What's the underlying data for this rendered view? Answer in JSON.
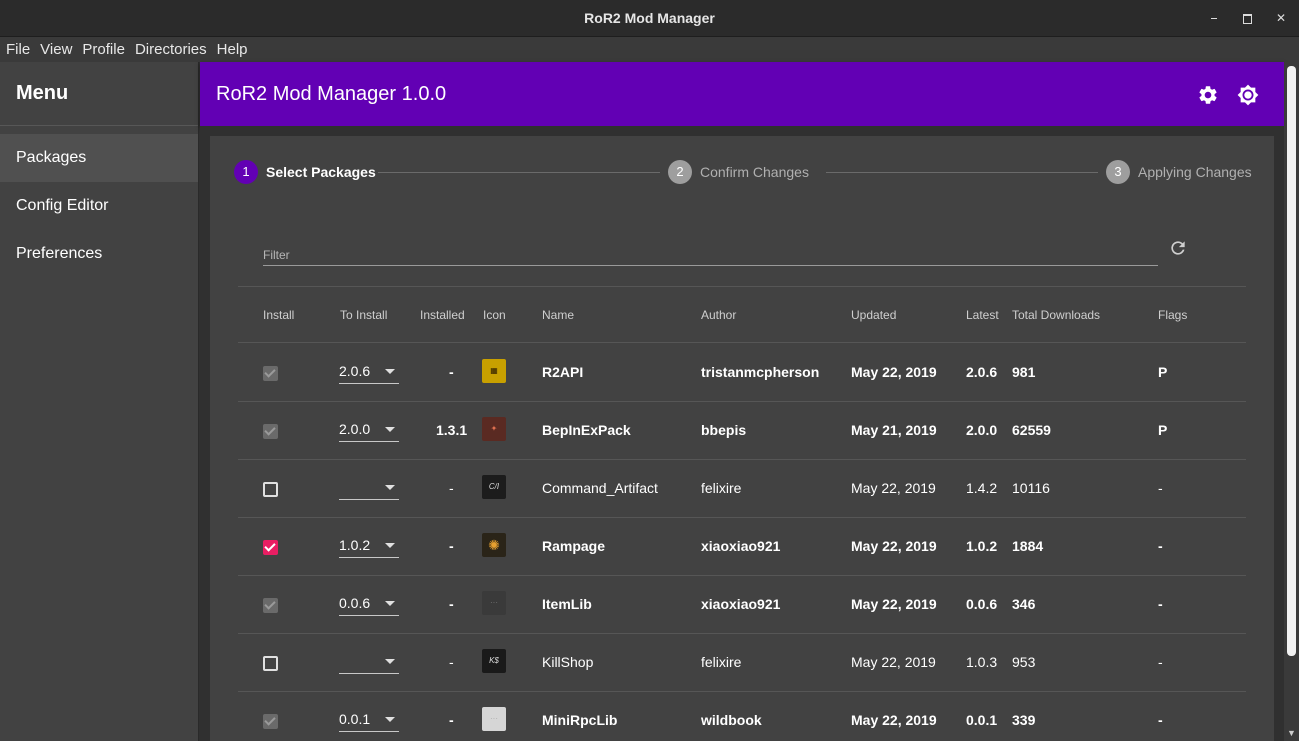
{
  "window": {
    "title": "RoR2 Mod Manager"
  },
  "menubar": {
    "items": [
      "File",
      "View",
      "Profile",
      "Directories",
      "Help"
    ]
  },
  "sidebar": {
    "header": "Menu",
    "items": [
      {
        "label": "Packages"
      },
      {
        "label": "Config Editor"
      },
      {
        "label": "Preferences"
      }
    ]
  },
  "appbar": {
    "title": "RoR2 Mod Manager 1.0.0"
  },
  "stepper": {
    "steps": [
      {
        "num": "1",
        "label": "Select Packages"
      },
      {
        "num": "2",
        "label": "Confirm Changes"
      },
      {
        "num": "3",
        "label": "Applying Changes"
      }
    ]
  },
  "filter": {
    "placeholder": "Filter"
  },
  "table": {
    "headers": [
      "Install",
      "To Install",
      "Installed",
      "Icon",
      "Name",
      "Author",
      "Updated",
      "Latest",
      "Total Downloads",
      "Flags"
    ],
    "rows": [
      {
        "to_install": "2.0.6",
        "installed": "-",
        "name": "R2API",
        "author": "tristanmcpherson",
        "updated": "May 22, 2019",
        "latest": "2.0.6",
        "downloads": "981",
        "flags": "P"
      },
      {
        "to_install": "2.0.0",
        "installed": "1.3.1",
        "name": "BepInExPack",
        "author": "bbepis",
        "updated": "May 21, 2019",
        "latest": "2.0.0",
        "downloads": "62559",
        "flags": "P"
      },
      {
        "to_install": "",
        "installed": "-",
        "name": "Command_Artifact",
        "author": "felixire",
        "updated": "May 22, 2019",
        "latest": "1.4.2",
        "downloads": "10116",
        "flags": "-"
      },
      {
        "to_install": "1.0.2",
        "installed": "-",
        "name": "Rampage",
        "author": "xiaoxiao921",
        "updated": "May 22, 2019",
        "latest": "1.0.2",
        "downloads": "1884",
        "flags": "-"
      },
      {
        "to_install": "0.0.6",
        "installed": "-",
        "name": "ItemLib",
        "author": "xiaoxiao921",
        "updated": "May 22, 2019",
        "latest": "0.0.6",
        "downloads": "346",
        "flags": "-"
      },
      {
        "to_install": "",
        "installed": "-",
        "name": "KillShop",
        "author": "felixire",
        "updated": "May 22, 2019",
        "latest": "1.0.3",
        "downloads": "953",
        "flags": "-"
      },
      {
        "to_install": "0.0.1",
        "installed": "-",
        "name": "MiniRpcLib",
        "author": "wildbook",
        "updated": "May 22, 2019",
        "latest": "0.0.1",
        "downloads": "339",
        "flags": "-"
      }
    ]
  },
  "colors": {
    "appbar": "#6200b4",
    "accent_check": "#e91e63",
    "background": "#303030",
    "paper": "#424242"
  }
}
